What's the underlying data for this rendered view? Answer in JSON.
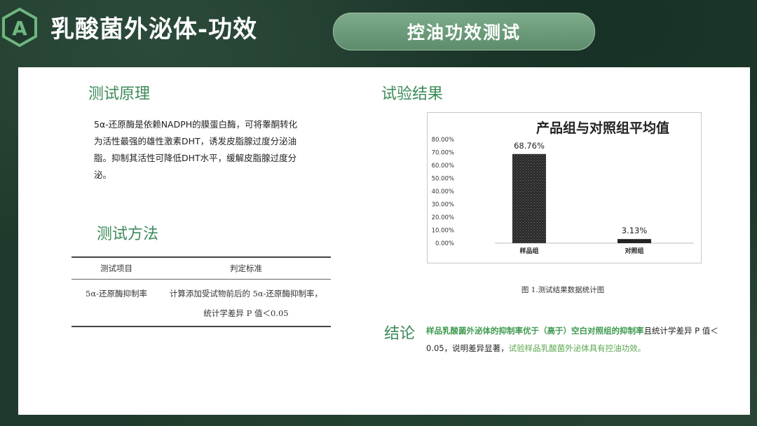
{
  "header": {
    "title": "乳酸菌外泌体-功效",
    "pill_label": "控油功效测试",
    "logo_letter": "A"
  },
  "principle": {
    "heading": "测试原理",
    "text": "5α-还原酶是依赖NADPH的膜蛋白酶，可将睾酮转化为活性最强的雄性激素DHT，诱发皮脂腺过度分泌油脂。抑制其活性可降低DHT水平，缓解皮脂腺过度分泌。"
  },
  "method": {
    "heading": "测试方法",
    "columns": [
      "测试项目",
      "判定标准"
    ],
    "rows": [
      [
        "5α-还原酶抑制率",
        "计算添加受试物前后的 5α-还原酶抑制率，统计学差异 P 值＜0.05"
      ]
    ]
  },
  "results": {
    "heading": "试验结果",
    "caption": "图 1.测试结果数据统计图"
  },
  "chart_data": {
    "type": "bar",
    "title": "产品组与对照组平均值",
    "categories": [
      "样品组",
      "对照组"
    ],
    "values": [
      68.76,
      3.13
    ],
    "value_labels": [
      "68.76%",
      "3.13%"
    ],
    "ylim": [
      0,
      80
    ],
    "yticks": [
      "0.00%",
      "10.00%",
      "20.00%",
      "30.00%",
      "40.00%",
      "50.00%",
      "60.00%",
      "70.00%",
      "80.00%"
    ],
    "xlabel": "",
    "ylabel": "",
    "grid": false
  },
  "conclusion": {
    "label": "结论",
    "part1": "样品乳酸菌外泌体的抑制率优于（高于）空白对照组的抑制率",
    "part2": "且统计学差异 P 值＜0.05，说明差异显著，",
    "part3": "试验样品乳酸菌外泌体具有控油功效。"
  },
  "colors": {
    "accent_green": "#3d8a5a",
    "pill": "#6e9e7c",
    "bar": "#2e2e2e",
    "background": "#1f3a2c"
  }
}
